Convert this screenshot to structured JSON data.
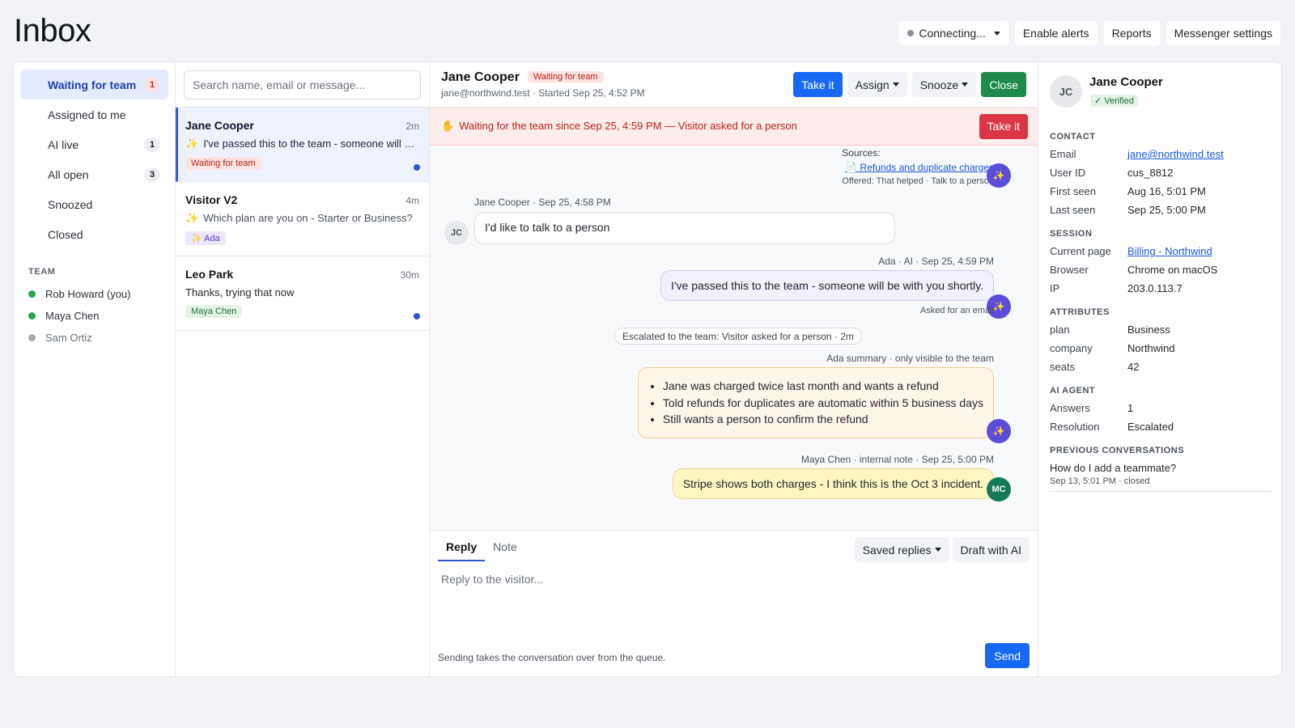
{
  "page": {
    "title": "Inbox"
  },
  "top_actions": {
    "connection": "Connecting...",
    "enable_alerts": "Enable alerts",
    "reports": "Reports",
    "messenger_settings": "Messenger settings"
  },
  "sidebar": {
    "items": [
      {
        "label": "Waiting for team",
        "count": "1"
      },
      {
        "label": "Assigned to me",
        "count": ""
      },
      {
        "label": "AI live",
        "count": "1"
      },
      {
        "label": "All open",
        "count": "3"
      },
      {
        "label": "Snoozed",
        "count": ""
      },
      {
        "label": "Closed",
        "count": ""
      }
    ],
    "team_heading": "TEAM",
    "team": [
      {
        "name": "Rob Howard (you)",
        "status": "online"
      },
      {
        "name": "Maya Chen",
        "status": "online"
      },
      {
        "name": "Sam Ortiz",
        "status": "offline"
      }
    ]
  },
  "search": {
    "placeholder": "Search name, email or message..."
  },
  "conversations": [
    {
      "name": "Jane Cooper",
      "time": "2m",
      "preview": "I've passed this to the team - someone will be with you shortly.",
      "tag": "Waiting for team",
      "unread": true
    },
    {
      "name": "Visitor V2",
      "time": "4m",
      "preview": "Which plan are you on - Starter or Business?",
      "tag": "✨ Ada",
      "unread": false
    },
    {
      "name": "Leo Park",
      "time": "30m",
      "preview": "Thanks, trying that now",
      "tag": "Maya Chen",
      "unread": true
    }
  ],
  "header": {
    "name": "Jane Cooper",
    "status_tag": "Waiting for team",
    "sub": "jane@northwind.test · Started Sep 25, 4:52 PM",
    "take_it": "Take it",
    "assign": "Assign",
    "snooze": "Snooze",
    "close": "Close"
  },
  "alert": {
    "text": "Waiting for the team since Sep 25, 4:59 PM — Visitor asked for a person",
    "action": "Take it"
  },
  "thread": {
    "sources_label": "Sources:",
    "source_link": "📄 Refunds and duplicate charges",
    "source_meta": "Offered: That helped · Talk to a person",
    "visitor_meta": "Jane Cooper · Sep 25, 4:58 PM",
    "visitor_initials": "JC",
    "visitor_message": "I'd like to talk to a person",
    "ai_meta": "Ada · AI · Sep 25, 4:59 PM",
    "ai_message": "I've passed this to the team - someone will be with you shortly.",
    "ai_footer": "Asked for an email",
    "escalated": "Escalated to the team: Visitor asked for a person · 2m",
    "summary_meta": "Ada summary · only visible to the team",
    "summary_points": [
      "Jane was charged twice last month and wants a refund",
      "Told refunds for duplicates are automatic within 5 business days",
      "Still wants a person to confirm the refund"
    ],
    "note_meta": "Maya Chen · internal note · Sep 25, 5:00 PM",
    "note_message": "Stripe shows both charges - I think this is the Oct 3 incident.",
    "note_initials": "MC"
  },
  "composer": {
    "tab_reply": "Reply",
    "tab_note": "Note",
    "saved_replies": "Saved replies",
    "draft_ai": "Draft with AI",
    "placeholder": "Reply to the visitor...",
    "hint": "Sending takes the conversation over from the queue.",
    "send": "Send"
  },
  "details": {
    "initials": "JC",
    "name": "Jane Cooper",
    "verified": "✓ Verified",
    "contact_heading": "CONTACT",
    "contact": [
      {
        "k": "Email",
        "v": "jane@northwind.test",
        "link": true
      },
      {
        "k": "User ID",
        "v": "cus_8812",
        "link": false
      },
      {
        "k": "First seen",
        "v": "Aug 16, 5:01 PM",
        "link": false
      },
      {
        "k": "Last seen",
        "v": "Sep 25, 5:00 PM",
        "link": false
      }
    ],
    "session_heading": "SESSION",
    "session": [
      {
        "k": "Current page",
        "v": "Billing - Northwind",
        "link": true
      },
      {
        "k": "Browser",
        "v": "Chrome on macOS",
        "link": false
      },
      {
        "k": "IP",
        "v": "203.0.113.7",
        "link": false
      }
    ],
    "attributes_heading": "ATTRIBUTES",
    "attributes": [
      {
        "k": "plan",
        "v": "Business"
      },
      {
        "k": "company",
        "v": "Northwind"
      },
      {
        "k": "seats",
        "v": "42"
      }
    ],
    "ai_heading": "AI AGENT",
    "ai": [
      {
        "k": "Answers",
        "v": "1"
      },
      {
        "k": "Resolution",
        "v": "Escalated"
      }
    ],
    "prev_heading": "PREVIOUS CONVERSATIONS",
    "prev_title": "How do I add a teammate?",
    "prev_meta": "Sep 13, 5:01 PM · closed"
  },
  "colors": {
    "accent": "#1769f5",
    "danger": "#dc3545",
    "success": "#1f8a4c",
    "ai": "#5b4cdb"
  }
}
